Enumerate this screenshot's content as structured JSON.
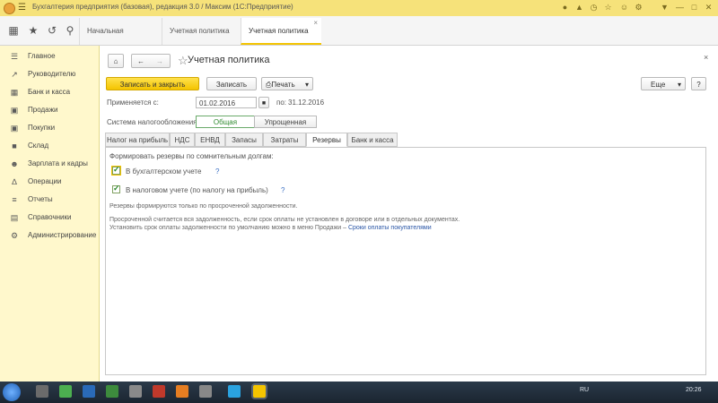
{
  "window": {
    "title": "Бухгалтерия предприятия (базовая), редакция 3.0 / Максим (1С:Предприятие)"
  },
  "tabs": [
    {
      "label": "Начальная страница"
    },
    {
      "label": "Учетная политика"
    },
    {
      "label": "Учетная политика"
    }
  ],
  "sidebar": {
    "items": [
      {
        "label": "Главное",
        "icon": "menu-icon"
      },
      {
        "label": "Руководителю",
        "icon": "chart-icon"
      },
      {
        "label": "Банк и касса",
        "icon": "bank-icon"
      },
      {
        "label": "Продажи",
        "icon": "cart-icon"
      },
      {
        "label": "Покупки",
        "icon": "basket-icon"
      },
      {
        "label": "Склад",
        "icon": "warehouse-icon"
      },
      {
        "label": "Зарплата и кадры",
        "icon": "people-icon"
      },
      {
        "label": "Операции",
        "icon": "operations-icon"
      },
      {
        "label": "Отчеты",
        "icon": "report-icon"
      },
      {
        "label": "Справочники",
        "icon": "book-icon"
      },
      {
        "label": "Администрирование",
        "icon": "gear-icon"
      }
    ]
  },
  "form": {
    "title": "Учетная политика",
    "save_close_label": "Записать и закрыть",
    "save_label": "Записать",
    "print_label": "Печать",
    "more_label": "Еще",
    "help_label": "?",
    "applied_from_label": "Применяется с:",
    "applied_from_value": "01.02.2016",
    "applied_to_label": "по:",
    "applied_to_value": "31.12.2016",
    "tax_system_label": "Система налогообложения:",
    "tax_system_options": [
      "Общая",
      "Упрощенная"
    ],
    "tax_system_selected": "Общая",
    "section_tabs": [
      {
        "label": "Налог на прибыль"
      },
      {
        "label": "НДС"
      },
      {
        "label": "ЕНВД"
      },
      {
        "label": "Запасы"
      },
      {
        "label": "Затраты"
      },
      {
        "label": "Резервы"
      },
      {
        "label": "Банк и касса"
      }
    ],
    "active_tab": "Резервы",
    "reserves": {
      "heading": "Формировать резервы по сомнительным долгам:",
      "option1_label": "В бухгалтерском учете",
      "option1_checked": true,
      "option2_label": "В налоговом учете (по налогу на прибыль)",
      "option2_checked": true,
      "help": "?",
      "note1": "Резервы формируются только по просроченной задолженности.",
      "note2": "Просроченной считается вся задолженность, если срок оплаты не установлен в договоре или в отдельных документах.",
      "note3_prefix": "Установить срок оплаты задолженности по умолчанию можно в меню Продажи –",
      "note3_link": "Сроки оплаты покупателями"
    }
  },
  "taskbar": {
    "lang": "RU",
    "clock": "20:26"
  },
  "colors": {
    "accent": "#f4c400",
    "sidebar_bg": "#fff8cc",
    "titlebar_bg": "#f6e27a"
  }
}
